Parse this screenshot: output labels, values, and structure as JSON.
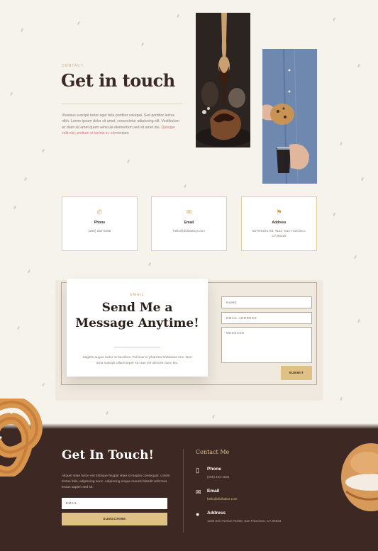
{
  "hero": {
    "eyebrow": "CONTACT",
    "title": "Get in touch",
    "body_main": "Vivamus suscipit tortor eget felis porttitor volutpat. Sed porttitor lectus nibh. Lorem ipsum dolor sit amet, consectetur adipiscing elit. Vestibulum ac diam sit amet quam vehicula elementum sed sit amet dui.",
    "body_highlight": "Quisque velit nisi, pretium ut lacinia in, elem",
    "body_end": "entum"
  },
  "cards": [
    {
      "icon": "phone-icon",
      "title": "Phone",
      "value": "(255) 352-6258"
    },
    {
      "icon": "email-icon",
      "title": "Email",
      "value": "hello@divibakery.com"
    },
    {
      "icon": "map-icon",
      "title": "Address",
      "value": "5678 Extra Rd. #123, San Francisco, CA 96120"
    }
  ],
  "form_section": {
    "eyebrow": "EMAIL",
    "title": "Send Me a Message Anytime!",
    "body": "Sagittis augue tortor ut faucibus. Pulvinar in pharetra habitasse nec. Non urna suscipit ullamcorper sit cras vel ultricies nunc leo.",
    "fields": {
      "name_placeholder": "NAME",
      "email_placeholder": "EMAIL ADDRESS",
      "message_placeholder": "MESSAGE"
    },
    "submit_label": "SUBMIT"
  },
  "footer": {
    "title": "Get In Touch!",
    "body": "Aliquet vitae fusce est tristique feugiat vitae id magna consequat. Lorem lectus felis, adipiscing nunc. Adipiscing neque mauris blandit velit mus lectus sapien sed sit.",
    "email_placeholder": "EMAIL",
    "subscribe_label": "SUBSCRIBE",
    "contact_title": "Contact Me",
    "contacts": [
      {
        "icon": "phone-icon",
        "label": "Phone",
        "value": "(255) 462-4634"
      },
      {
        "icon": "email-icon",
        "label": "Email",
        "value": "hello@divibaker.com"
      },
      {
        "icon": "location-pin-icon",
        "label": "Address",
        "value": "1235 Divi Avenue #1000, San Francisco, CA 99623"
      }
    ]
  },
  "colors": {
    "background": "#f6f3ed",
    "accent_gold": "#dfc185",
    "footer_brown": "#3d2823",
    "heading": "#3b2a23"
  }
}
